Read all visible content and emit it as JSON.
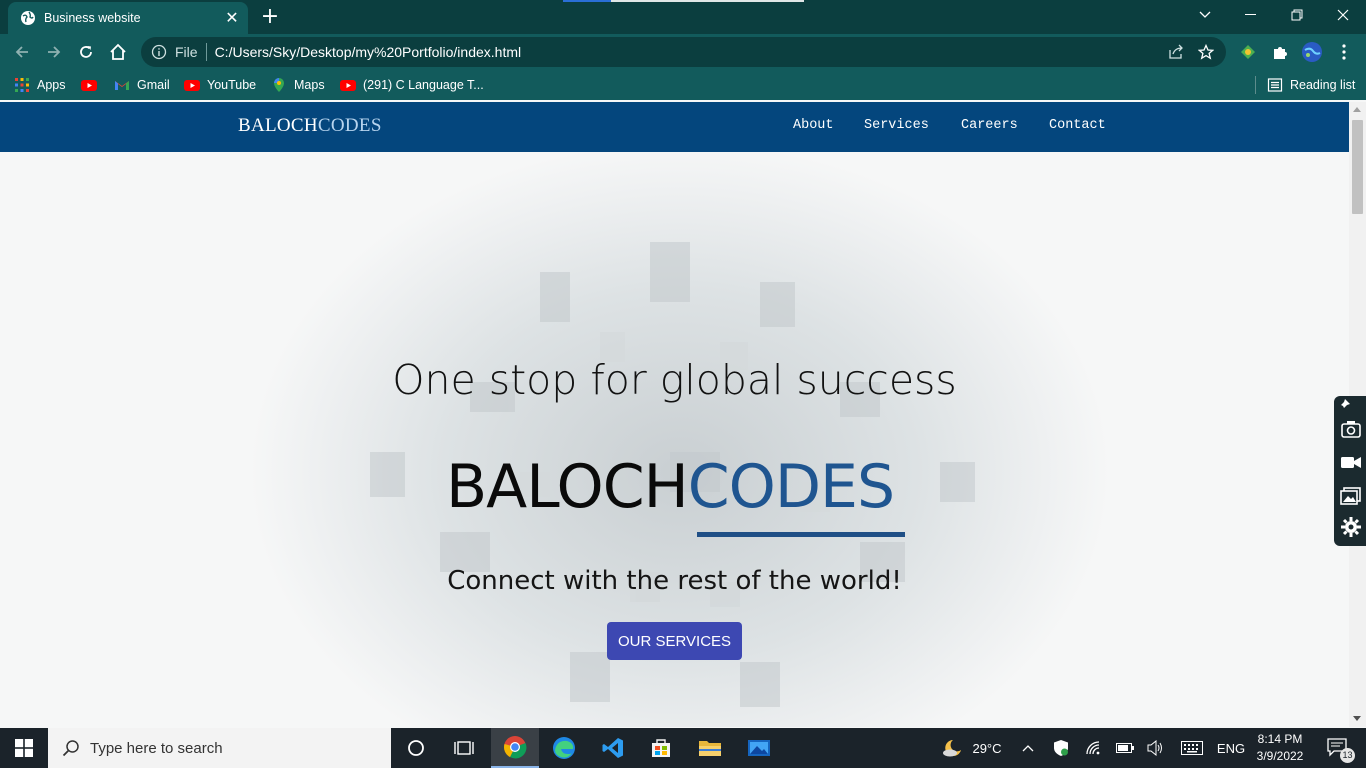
{
  "browser": {
    "tab_title": "Business website",
    "omnibox_scheme": "File",
    "url": "C:/Users/Sky/Desktop/my%20Portfolio/index.html",
    "bookmarks": [
      {
        "label": "Apps",
        "icon": "apps-grid-icon"
      },
      {
        "label": "",
        "icon": "youtube-icon"
      },
      {
        "label": "Gmail",
        "icon": "gmail-icon"
      },
      {
        "label": "YouTube",
        "icon": "youtube-icon"
      },
      {
        "label": "Maps",
        "icon": "maps-icon"
      },
      {
        "label": "(291) C Language T...",
        "icon": "youtube-icon"
      }
    ],
    "reading_list": "Reading list"
  },
  "site": {
    "brand_part1": "BALOCH",
    "brand_part2": "CODES",
    "nav": [
      "About",
      "Services",
      "Careers",
      "Contact"
    ],
    "hero": {
      "title": "One stop for global success",
      "brand_part1": "BALOCH",
      "brand_part2": "CODES",
      "subtitle": "Connect with the rest of the world!",
      "button": "OUR SERVICES"
    },
    "colors": {
      "nav_bg": "#04467d",
      "accent": "#1f5590",
      "button": "#3d48b2"
    }
  },
  "taskbar": {
    "search_placeholder": "Type here to search",
    "weather": "29°C",
    "language": "ENG",
    "time": "8:14 PM",
    "date": "3/9/2022",
    "notifications": "13"
  }
}
